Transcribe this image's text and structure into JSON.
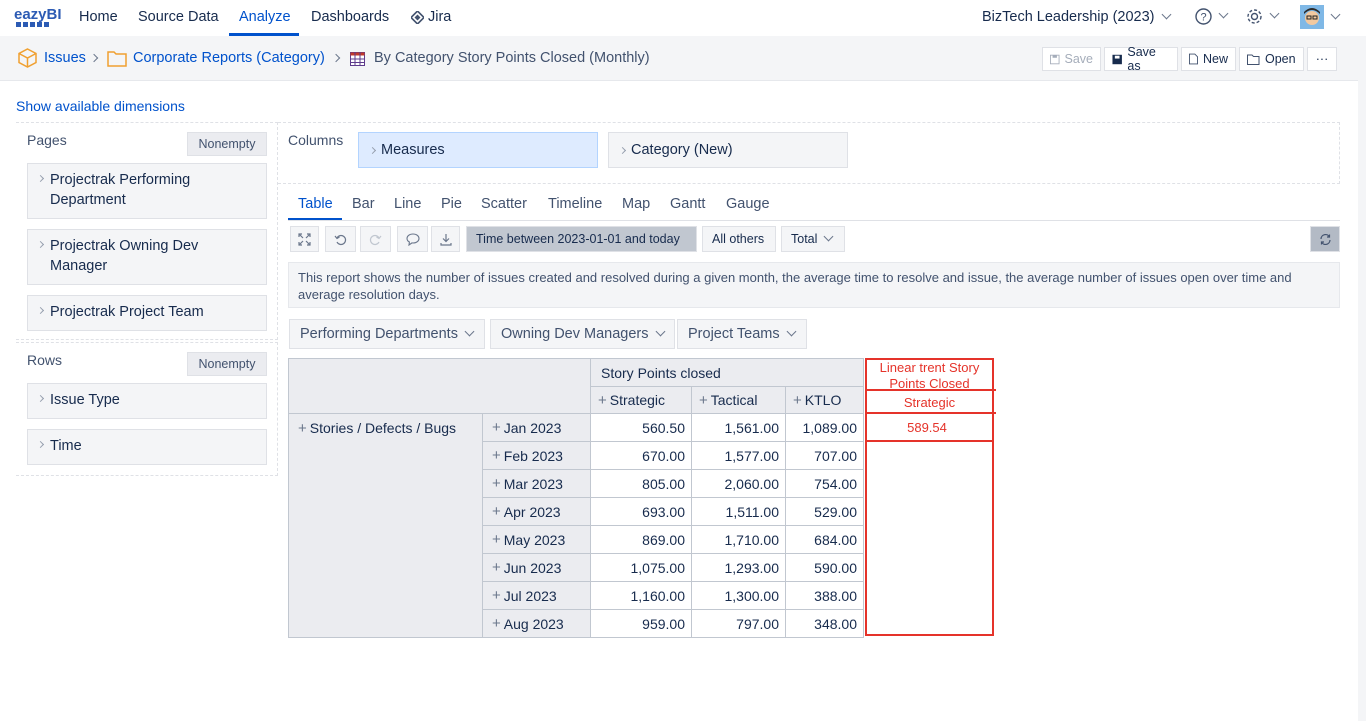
{
  "nav": {
    "logo": "eazyBI",
    "items": [
      "Home",
      "Source Data",
      "Analyze",
      "Dashboards",
      "Jira"
    ],
    "account": "BizTech Leadership (2023)"
  },
  "breadcrumb": {
    "items": [
      "Issues",
      "Corporate Reports (Category)",
      "By Category Story Points Closed (Monthly)"
    ]
  },
  "toolbar": {
    "save": "Save",
    "save_as": "Save as",
    "new": "New",
    "open": "Open",
    "more": "···"
  },
  "left": {
    "show_dimensions": "Show available dimensions",
    "pages_label": "Pages",
    "pages_nonempty": "Nonempty",
    "pages": [
      "Projectrak Performing Department",
      "Projectrak Owning Dev Manager",
      "Projectrak Project Team"
    ],
    "rows_label": "Rows",
    "rows_nonempty": "Nonempty",
    "rows": [
      "Issue Type",
      "Time"
    ]
  },
  "columns": {
    "label": "Columns",
    "items": [
      "Measures",
      "Category (New)"
    ]
  },
  "view_tabs": [
    "Table",
    "Bar",
    "Line",
    "Pie",
    "Scatter",
    "Timeline",
    "Map",
    "Gantt",
    "Gauge"
  ],
  "filters": {
    "time": "Time between 2023-01-01 and today",
    "all_others": "All others",
    "total": "Total"
  },
  "description": "This report shows the number of issues created and resolved during a given month, the average time to resolve and issue, the average number of issues open over time and average resolution days.",
  "page_selects": [
    "Performing Departments",
    "Owning Dev Managers",
    "Project Teams"
  ],
  "table": {
    "measure": "Story Points closed",
    "columns": [
      "Strategic",
      "Tactical",
      "KTLO"
    ],
    "row_group": "Stories / Defects / Bugs",
    "rows": [
      {
        "month": "Jan 2023",
        "values": [
          "560.50",
          "1,561.00",
          "1,089.00"
        ]
      },
      {
        "month": "Feb 2023",
        "values": [
          "670.00",
          "1,577.00",
          "707.00"
        ]
      },
      {
        "month": "Mar 2023",
        "values": [
          "805.00",
          "2,060.00",
          "754.00"
        ]
      },
      {
        "month": "Apr 2023",
        "values": [
          "693.00",
          "1,511.00",
          "529.00"
        ]
      },
      {
        "month": "May 2023",
        "values": [
          "869.00",
          "1,710.00",
          "684.00"
        ]
      },
      {
        "month": "Jun 2023",
        "values": [
          "1,075.00",
          "1,293.00",
          "590.00"
        ]
      },
      {
        "month": "Jul 2023",
        "values": [
          "1,160.00",
          "1,300.00",
          "388.00"
        ]
      },
      {
        "month": "Aug 2023",
        "values": [
          "959.00",
          "797.00",
          "348.00"
        ]
      }
    ],
    "annotation": {
      "title": "Linear trent Story Points Closed",
      "column": "Strategic",
      "value": "589.54"
    }
  },
  "colors": {
    "accent": "#0052cc",
    "annotation": "#e5332a"
  }
}
